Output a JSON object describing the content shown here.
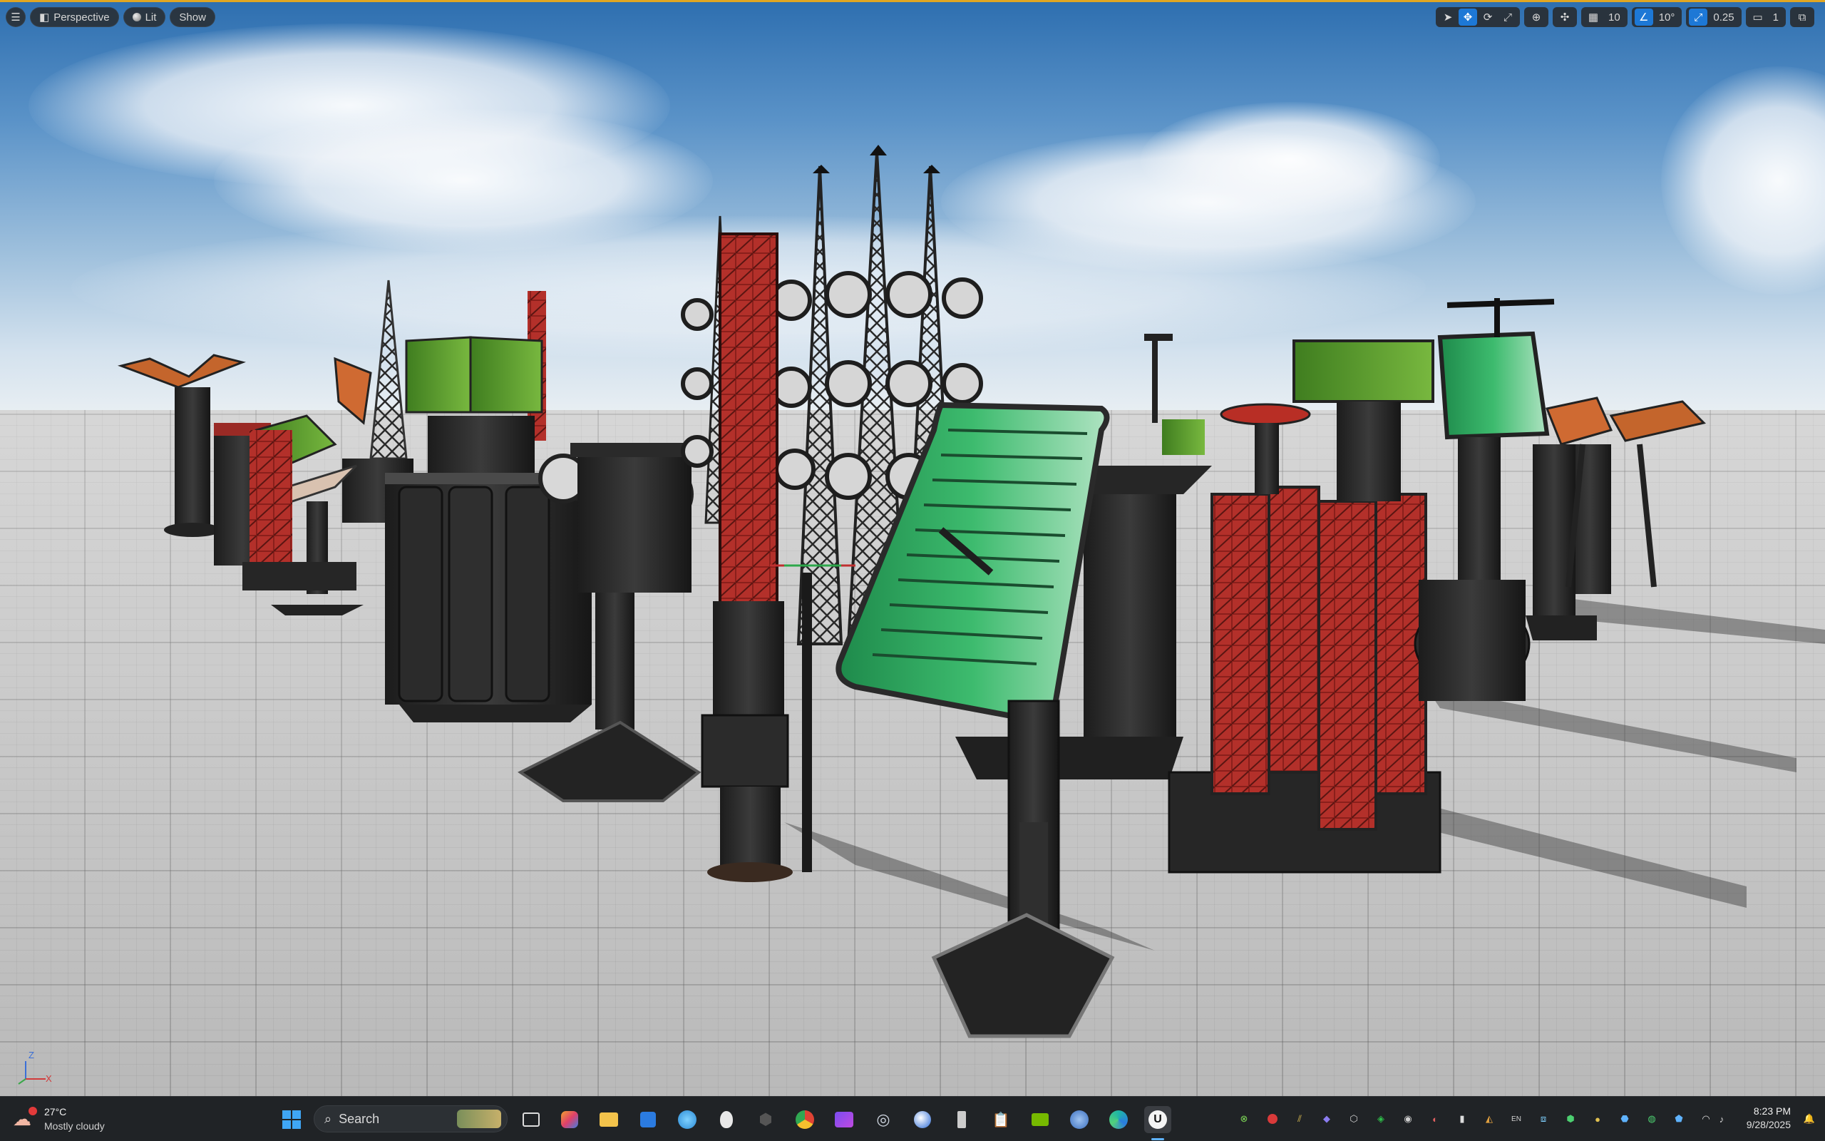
{
  "toolbar": {
    "menu_icon": "hamburger-menu-icon",
    "perspective_label": "Perspective",
    "lit_label": "Lit",
    "show_label": "Show",
    "grid_snap_value": "10",
    "rotation_snap_value": "10°",
    "scale_snap_value": "0.25",
    "camera_speed_value": "1",
    "accent_color": "#1d78d6",
    "viewport_border_color": "#e0a623"
  },
  "axis_gizmo": {
    "z": "Z",
    "x": "X"
  },
  "taskbar": {
    "weather_temp": "27°C",
    "weather_desc": "Mostly cloudy",
    "search_placeholder": "Search",
    "time": "8:23 PM",
    "date": "9/28/2025",
    "pinned_apps": [
      "start-icon",
      "search-icon",
      "task-view-icon",
      "copilot-icon",
      "file-explorer-icon",
      "microsoft-store-icon",
      "maps-icon",
      "alien-app-icon",
      "shield-app-icon",
      "chrome-icon",
      "video-editor-icon",
      "steam-icon",
      "browser-icon",
      "usb-tool-icon",
      "clipboard-tool-icon",
      "nvidia-icon",
      "globe-app-icon",
      "edge-icon",
      "unreal-engine-icon"
    ],
    "tray_icons": [
      "xbox-icon",
      "record-icon",
      "graph-icon",
      "discord-icon",
      "cube-icon",
      "g-hub-icon",
      "chrome-icon",
      "cursor-icon",
      "battery-icon",
      "tray-app-icon",
      "network-icon",
      "ime-icon",
      "tray-app-icon-2",
      "shield-icon",
      "tray-app-icon-3",
      "wifi-icon",
      "volume-icon",
      "bluetooth-icon",
      "notification-icon"
    ]
  }
}
